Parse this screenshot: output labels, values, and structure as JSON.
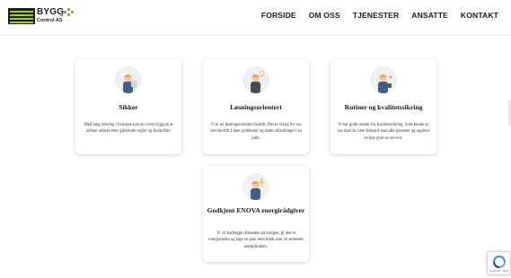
{
  "logo": {
    "name": "BYGG",
    "sub": "Control AS"
  },
  "nav": [
    {
      "label": "FORSIDE"
    },
    {
      "label": "OM OSS"
    },
    {
      "label": "TJENESTER"
    },
    {
      "label": "ANSATTE"
    },
    {
      "label": "KONTAKT"
    }
  ],
  "cards": [
    {
      "title": "Sikker",
      "text": "Med lang erfaring i bransjen kan du være trygg på at jobben utføres etter gjeldende regler og forskrifter.",
      "icon": "inspector-avatar-icon"
    },
    {
      "title": "Løsningsorientert",
      "text": "Vi er en løsningsorientert bedrift. Det er viktig for oss som bedrift å løse problemer og møte utfordringer i en jobb.",
      "icon": "thinking-worker-avatar-icon"
    },
    {
      "title": "Rutiner og kvalitetssikring",
      "text": "Vi har gode rutiner for kvalitetssikring. Som kunde av oss skal du være fornøyd med alle tjenester og oppleve en høy grad av service.",
      "icon": "worker-avatar-icon"
    },
    {
      "title": "Godkjent ENOVA energirådgiver",
      "text": "Vi vil kartlegge tilstanden på boligen, gi den et energimerke og lage en plan med tiltak som vil redusere energibruken.",
      "icon": "energy-advisor-avatar-icon"
    }
  ],
  "recaptcha": {
    "label": "Personvern · Vilkår"
  },
  "colors": {
    "brand_green": "#9acd32",
    "brand_dark": "#1f1f1f",
    "helmet_orange": "#f4a340",
    "shirt_blue": "#3f5f8a"
  }
}
